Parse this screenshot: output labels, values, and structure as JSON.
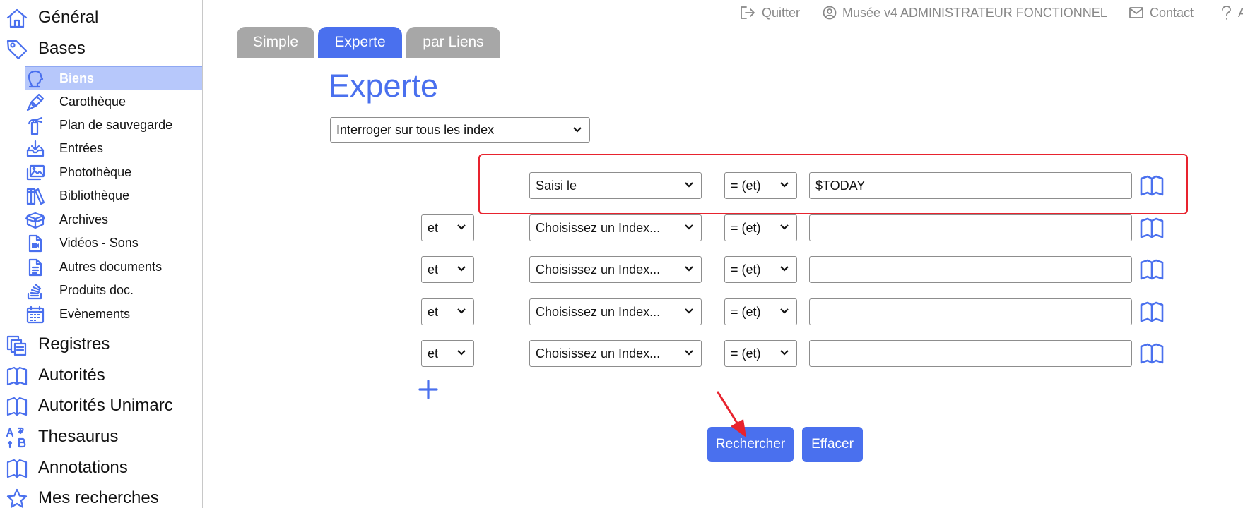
{
  "sidebar": {
    "top_items": [
      {
        "label": "Général",
        "icon": "home-icon"
      },
      {
        "label": "Bases",
        "icon": "tag-icon"
      }
    ],
    "sub_items": [
      {
        "label": "Biens",
        "icon": "bust-icon",
        "active": true
      },
      {
        "label": "Carothèque",
        "icon": "pen-nib-icon"
      },
      {
        "label": "Plan de sauvegarde",
        "icon": "fire-extinguisher-icon"
      },
      {
        "label": "Entrées",
        "icon": "inbox-download-icon"
      },
      {
        "label": "Photothèque",
        "icon": "images-icon"
      },
      {
        "label": "Bibliothèque",
        "icon": "books-icon"
      },
      {
        "label": "Archives",
        "icon": "box-icon"
      },
      {
        "label": "Vidéos - Sons",
        "icon": "video-file-icon"
      },
      {
        "label": "Autres documents",
        "icon": "document-icon"
      },
      {
        "label": "Produits doc.",
        "icon": "stack-icon"
      },
      {
        "label": "Evènements",
        "icon": "calendar-icon"
      }
    ],
    "bottom_items": [
      {
        "label": "Registres",
        "icon": "registers-icon"
      },
      {
        "label": "Autorités",
        "icon": "open-book-icon"
      },
      {
        "label": "Autorités Unimarc",
        "icon": "open-book-icon"
      },
      {
        "label": "Thesaurus",
        "icon": "sort-alpha-icon"
      },
      {
        "label": "Annotations",
        "icon": "open-book-icon"
      },
      {
        "label": "Mes recherches",
        "icon": "star-icon"
      }
    ]
  },
  "header": {
    "quit_label": "Quitter",
    "user_label": "Musée v4 ADMINISTRATEUR FONCTIONNEL",
    "contact_label": "Contact",
    "help_label": "A"
  },
  "tabs": [
    {
      "label": "Simple",
      "active": false
    },
    {
      "label": "Experte",
      "active": true
    },
    {
      "label": "par Liens",
      "active": false
    }
  ],
  "page_title": "Experte",
  "index_scope": "Interroger sur tous les index",
  "criteria": [
    {
      "connector": "",
      "index": "Saisi le",
      "operator": "= (et)",
      "value": "$TODAY"
    },
    {
      "connector": "et",
      "index": "Choisissez un Index...",
      "operator": "= (et)",
      "value": ""
    },
    {
      "connector": "et",
      "index": "Choisissez un Index...",
      "operator": "= (et)",
      "value": ""
    },
    {
      "connector": "et",
      "index": "Choisissez un Index...",
      "operator": "= (et)",
      "value": ""
    },
    {
      "connector": "et",
      "index": "Choisissez un Index...",
      "operator": "= (et)",
      "value": ""
    }
  ],
  "buttons": {
    "search_label": "Rechercher",
    "clear_label": "Effacer"
  },
  "colors": {
    "accent": "#4a70ee",
    "tab_inactive": "#a7a7a7",
    "active_sidebar_bg": "#b7c8fb",
    "highlight": "#e8232e"
  }
}
